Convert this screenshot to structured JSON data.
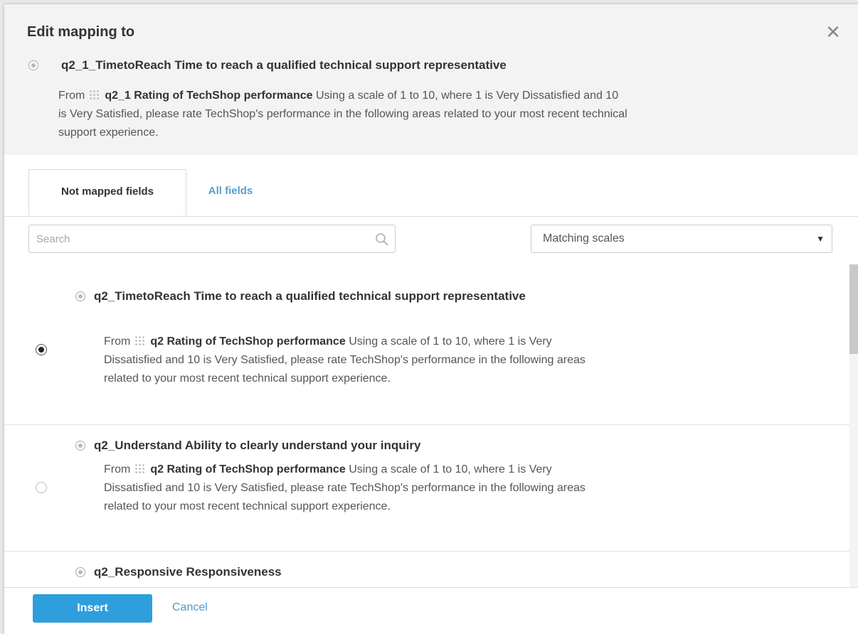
{
  "dialog": {
    "title": "Edit mapping to",
    "close_icon": "close-icon",
    "target": {
      "field": "q2_1_TimetoReach Time to reach a qualified technical support representative",
      "from_prefix": "From",
      "source_name": "q2_1 Rating of TechShop performance",
      "source_text": "Using a scale of 1 to 10, where 1 is Very Dissatisfied and 10 is Very Satisfied, please rate TechShop's performance in the following areas related to your most recent technical support experience."
    }
  },
  "tabs": [
    {
      "label": "Not mapped fields",
      "active": true
    },
    {
      "label": "All fields",
      "active": false
    }
  ],
  "search": {
    "placeholder": "Search",
    "value": ""
  },
  "filter": {
    "selected": "Matching scales"
  },
  "options": [
    {
      "field": "q2_TimetoReach Time to reach a qualified technical support representative",
      "from_prefix": "From",
      "source_name": "q2 Rating of TechShop performance",
      "source_text": "Using a scale of 1 to 10, where 1 is Very Dissatisfied and 10 is Very Satisfied, please rate TechShop's performance in the following areas related to your most recent technical support experience.",
      "selected": true
    },
    {
      "field": "q2_Understand Ability to clearly understand your inquiry",
      "from_prefix": "From",
      "source_name": "q2 Rating of TechShop performance",
      "source_text": "Using a scale of 1 to 10, where 1 is Very Dissatisfied and 10 is Very Satisfied, please rate TechShop's performance in the following areas related to your most recent technical support experience.",
      "selected": false
    },
    {
      "field": "q2_Responsive Responsiveness",
      "selected": false
    }
  ],
  "footer": {
    "insert_label": "Insert",
    "cancel_label": "Cancel"
  },
  "colors": {
    "primary": "#2e9fdc",
    "link": "#5a9fd0"
  }
}
